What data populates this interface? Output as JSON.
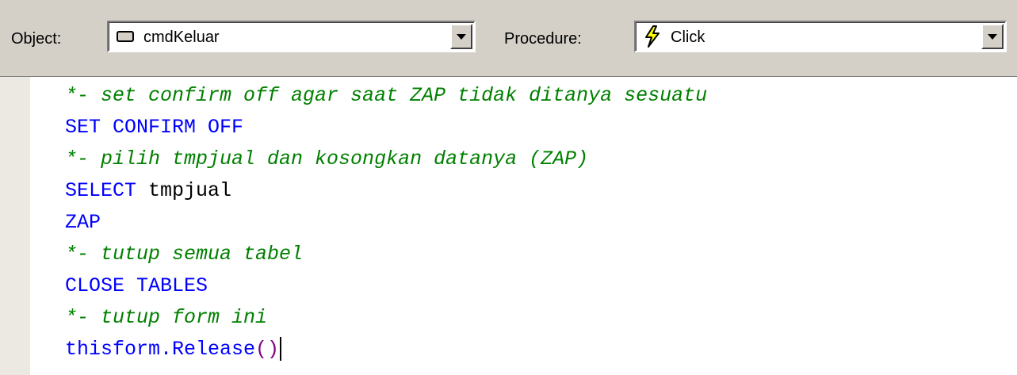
{
  "toolbar": {
    "object_label": "Object:",
    "object_value": "cmdKeluar",
    "procedure_label": "Procedure:",
    "procedure_value": "Click"
  },
  "code": {
    "line1": "*- set confirm off agar saat ZAP tidak ditanya sesuatu",
    "line2": "SET CONFIRM OFF",
    "line3": "*- pilih tmpjual dan kosongkan datanya (ZAP)",
    "line4_kw": "SELECT",
    "line4_rest": " tmpjual",
    "line5": "ZAP",
    "line6": "*- tutup semua tabel",
    "line7": "CLOSE TABLES",
    "line8": "*- tutup form ini",
    "line9_obj": "thisform.Release",
    "line9_paren": "()"
  },
  "colors": {
    "comment": "#008000",
    "keyword": "#0000ff",
    "plain": "#000000",
    "paren": "#800080",
    "toolbar_bg": "#d4d0c8"
  },
  "icons": {
    "object_icon": "command-button-icon",
    "procedure_icon": "lightning-bolt-icon"
  }
}
